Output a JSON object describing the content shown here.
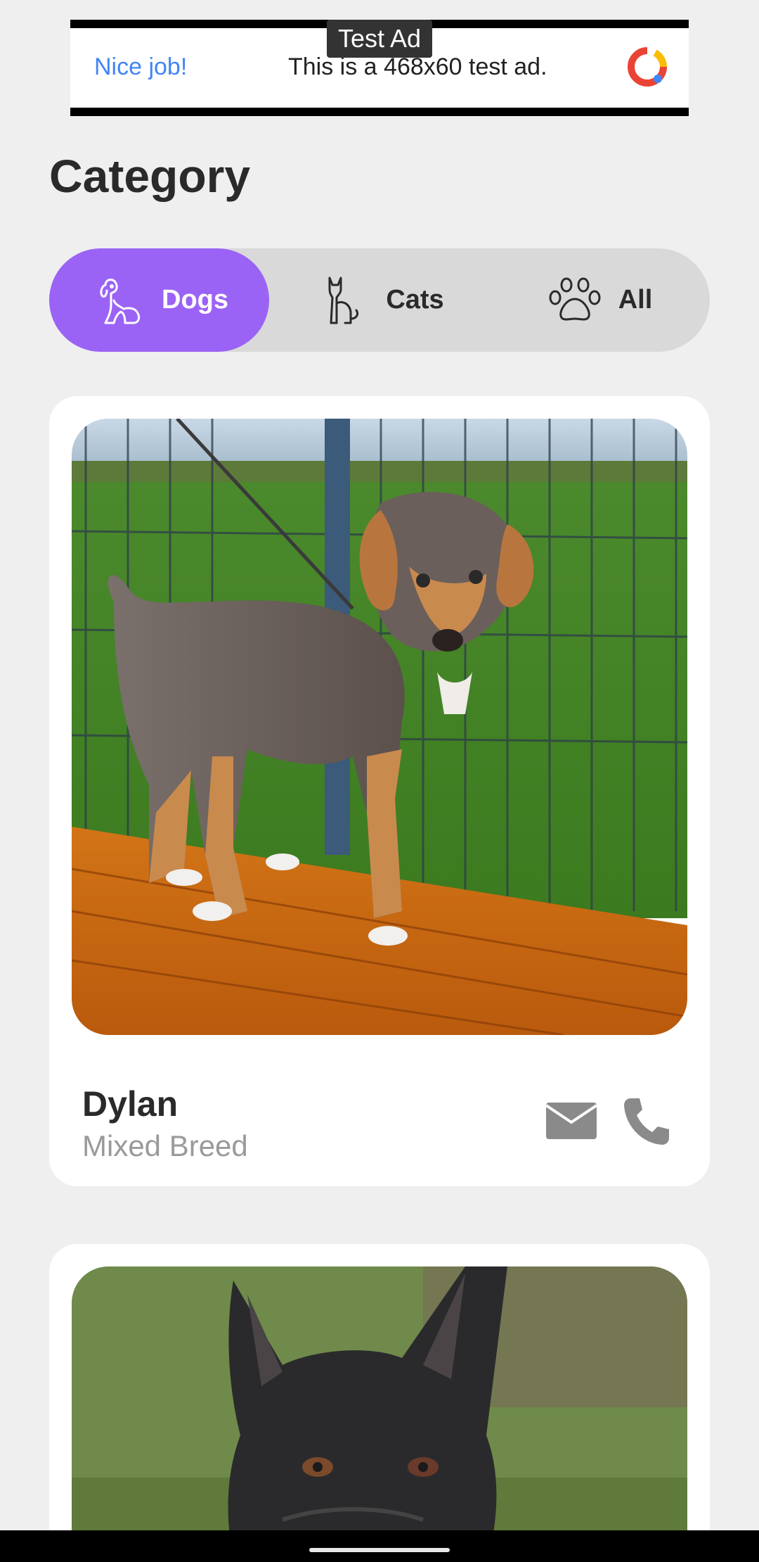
{
  "ad": {
    "label": "Test Ad",
    "nice_job": "Nice job!",
    "text": "This is a 468x60 test ad."
  },
  "page_title": "Category",
  "categories": [
    {
      "label": "Dogs",
      "icon": "dog-icon",
      "selected": true
    },
    {
      "label": "Cats",
      "icon": "cat-icon",
      "selected": false
    },
    {
      "label": "All",
      "icon": "paw-icon",
      "selected": false
    }
  ],
  "pets": [
    {
      "name": "Dylan",
      "breed": "Mixed Breed",
      "photo": "puppy-on-bench-photo"
    },
    {
      "name": "",
      "breed": "",
      "photo": "black-dog-photo"
    }
  ],
  "colors": {
    "accent": "#9b63f5",
    "segment_bg": "#d9d9d9",
    "background": "#efefef"
  }
}
